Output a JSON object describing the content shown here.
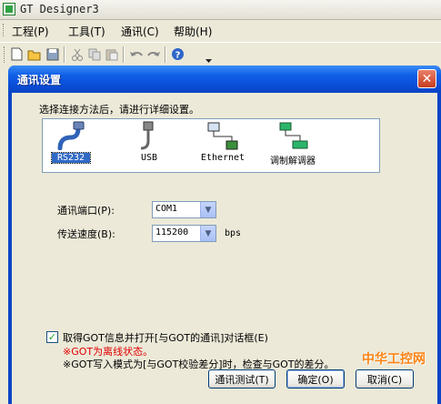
{
  "app": {
    "title": "GT Designer3"
  },
  "menu": {
    "items": [
      "工程(P)",
      "工具(T)",
      "通讯(C)",
      "帮助(H)"
    ]
  },
  "toolbar": {
    "icons": [
      "new-icon",
      "open-icon",
      "save-icon",
      "cut-icon",
      "copy-icon",
      "paste-icon",
      "undo-icon",
      "redo-icon",
      "help-icon",
      "dropdown-icon"
    ]
  },
  "dialog": {
    "title": "通讯设置",
    "close": "✕",
    "instruction": "选择连接方法后，请进行详细设置。",
    "methods": [
      {
        "label": "RS232",
        "selected": true
      },
      {
        "label": "USB",
        "selected": false
      },
      {
        "label": "Ethernet",
        "selected": false
      },
      {
        "label": "调制解调器",
        "selected": false
      }
    ],
    "port_label": "通讯端口(P):",
    "port_value": "COM1",
    "speed_label": "传送速度(B):",
    "speed_value": "115200",
    "speed_unit": "bps",
    "checkbox_checked": true,
    "checkbox_label": "取得GOT信息并打开[与GOT的通讯]对话框(E)",
    "warning": "※GOT为离线状态。",
    "note": "※GOT写入模式为[与GOT校验差分]时，检查与GOT的差分。",
    "test_button": "通讯测试(T)",
    "ok_button": "确定(O)",
    "cancel_button": "取消(C)",
    "colors": {
      "warning": "#e00000",
      "titlebar": "#0a4fd9",
      "watermark": "#ff7a00"
    }
  },
  "watermark": {
    "text": "中华工控网"
  }
}
